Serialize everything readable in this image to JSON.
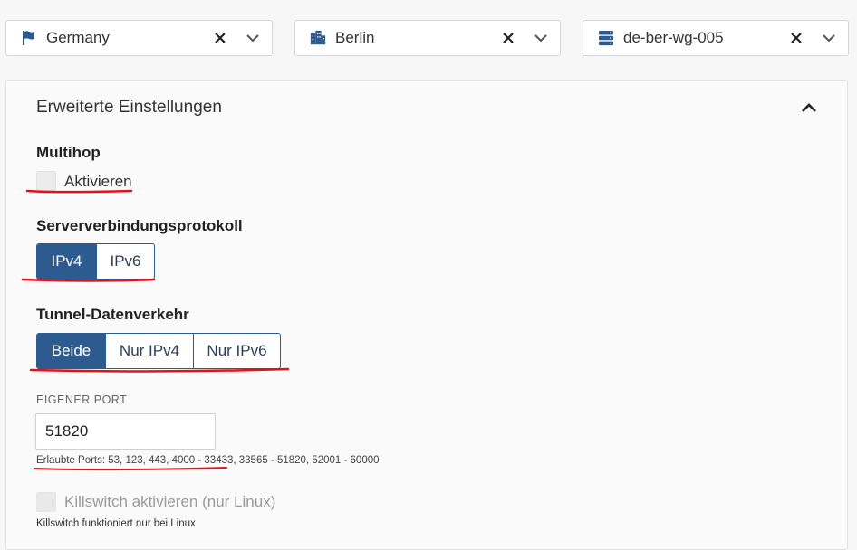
{
  "selectors": {
    "country": {
      "value": "Germany",
      "icon": "flag-icon"
    },
    "city": {
      "value": "Berlin",
      "icon": "city-icon"
    },
    "server": {
      "value": "de-ber-wg-005",
      "icon": "server-icon"
    }
  },
  "advanced": {
    "title": "Erweiterte Einstellungen",
    "multihop": {
      "label": "Multihop",
      "checkbox_label": "Aktivieren"
    },
    "protocol": {
      "label": "Serververbindungsprotokoll",
      "options": [
        "IPv4",
        "IPv6"
      ],
      "selected": "IPv4"
    },
    "tunnel": {
      "label": "Tunnel-Datenverkehr",
      "options": [
        "Beide",
        "Nur IPv4",
        "Nur IPv6"
      ],
      "selected": "Beide"
    },
    "port": {
      "label": "EIGENER PORT",
      "value": "51820",
      "help": "Erlaubte Ports: 53, 123, 443, 4000 - 33433, 33565 - 51820, 52001 - 60000"
    },
    "killswitch": {
      "label": "Killswitch aktivieren (nur Linux)",
      "help": "Killswitch funktioniert nur bei Linux"
    }
  },
  "colors": {
    "accent": "#2d5a8f",
    "annotation": "#e0131a"
  }
}
